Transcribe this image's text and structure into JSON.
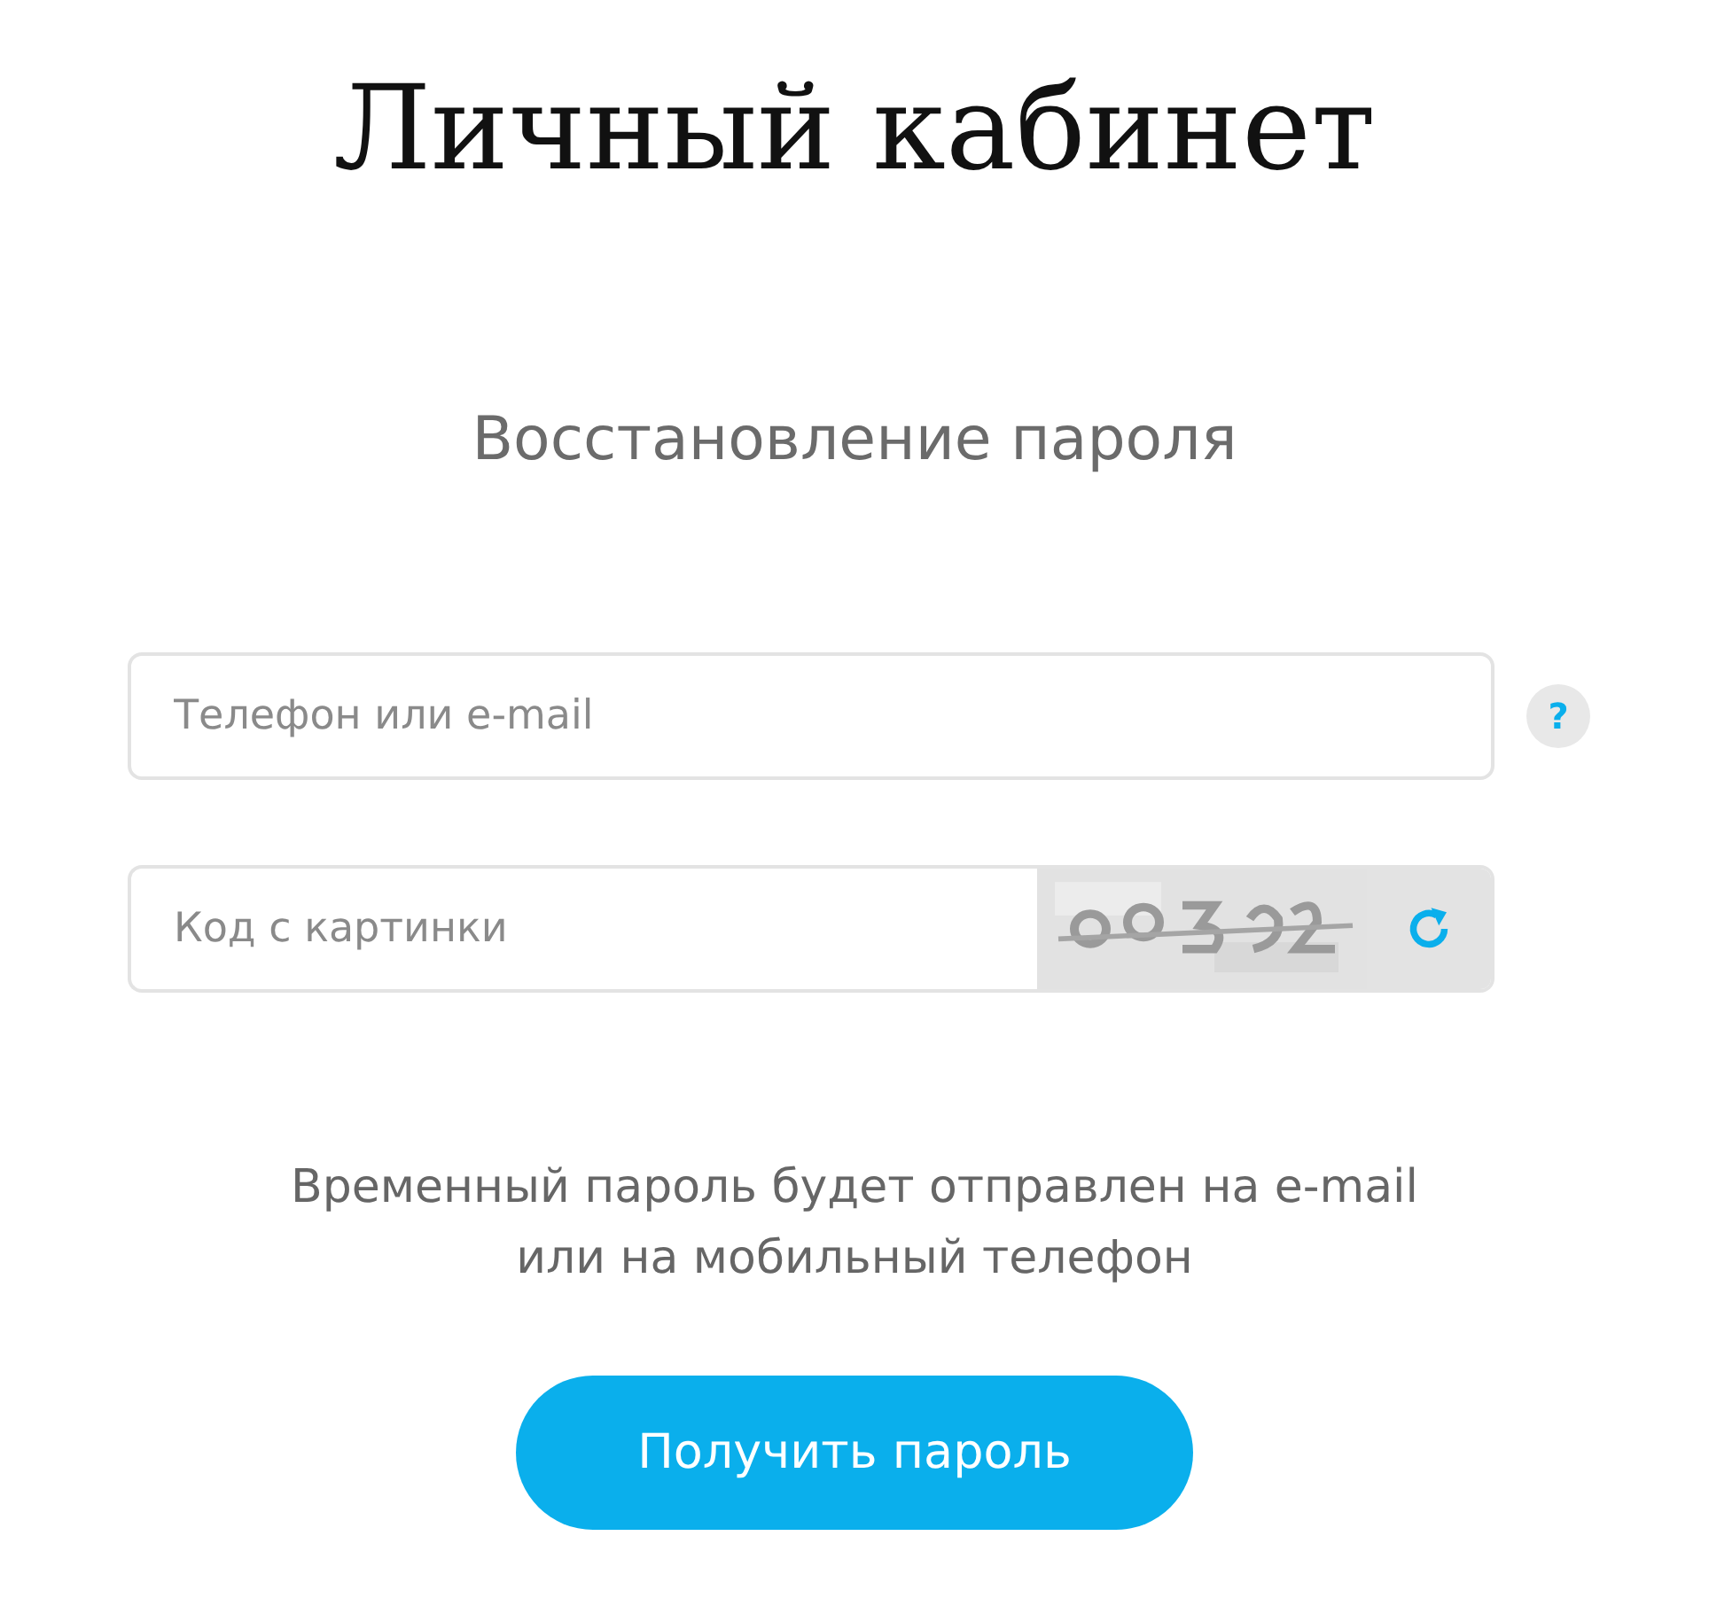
{
  "title": "Личный кабинет",
  "subtitle": "Восстановление пароля",
  "login_field": {
    "placeholder": "Телефон или e-mail"
  },
  "help": "?",
  "captcha_field": {
    "placeholder": "Код с картинки"
  },
  "note": [
    "Временный пароль будет отправлен на e-mail",
    "или на мобильный телефон"
  ],
  "button": "Получить пароль"
}
